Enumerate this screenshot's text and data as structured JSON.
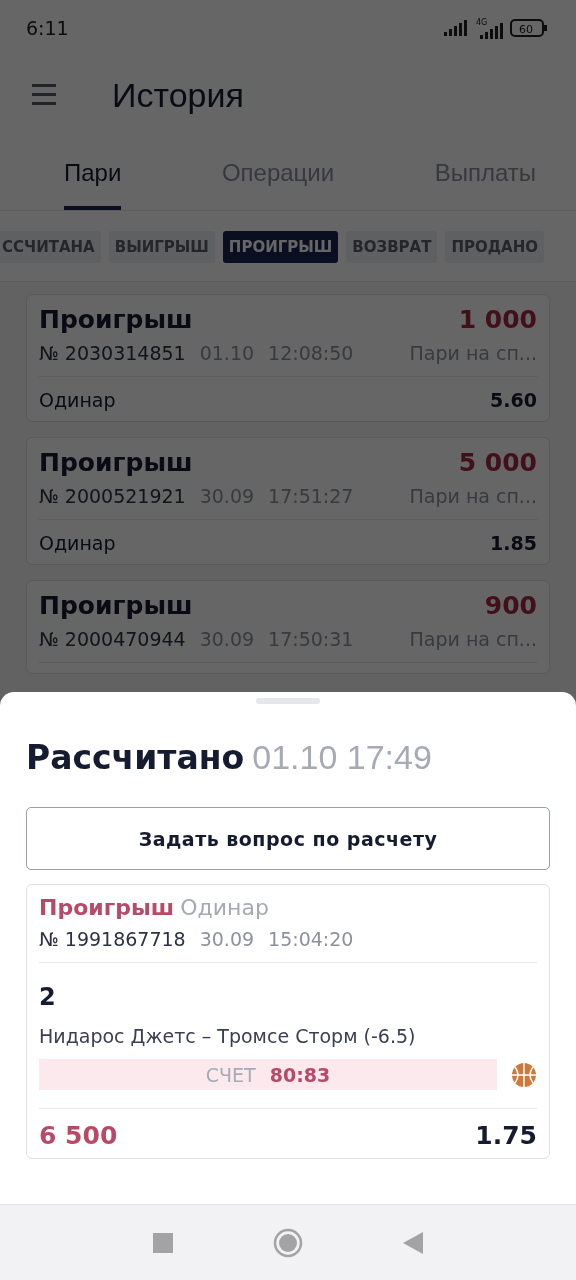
{
  "status_bar": {
    "time": "6:11",
    "network": "4G",
    "battery": "60"
  },
  "header": {
    "title": "История"
  },
  "tabs": [
    {
      "label": "Пари",
      "selected": true
    },
    {
      "label": "Операции",
      "selected": false
    },
    {
      "label": "Выплаты",
      "selected": false
    }
  ],
  "filters": [
    {
      "label": "ССЧИТАНА",
      "selected": false
    },
    {
      "label": "ВЫИГРЫШ",
      "selected": false
    },
    {
      "label": "ПРОИГРЫШ",
      "selected": true
    },
    {
      "label": "ВОЗВРАТ",
      "selected": false
    },
    {
      "label": "ПРОДАНО",
      "selected": false
    }
  ],
  "bets": [
    {
      "status": "Проигрыш",
      "amount": "1 000",
      "number": "№ 2030314851",
      "date": "01.10",
      "time": "12:08:50",
      "category": "Пари на сп...",
      "type": "Одинар",
      "odds": "5.60"
    },
    {
      "status": "Проигрыш",
      "amount": "5 000",
      "number": "№ 2000521921",
      "date": "30.09",
      "time": "17:51:27",
      "category": "Пари на сп...",
      "type": "Одинар",
      "odds": "1.85"
    },
    {
      "status": "Проигрыш",
      "amount": "900",
      "number": "№ 2000470944",
      "date": "30.09",
      "time": "17:50:31",
      "category": "Пари на сп..."
    }
  ],
  "sheet": {
    "title": "Рассчитано",
    "datetime": "01.10 17:49",
    "button": "Задать вопрос по расчету",
    "bet": {
      "status": "Проигрыш",
      "type": "Одинар",
      "number": "№ 1991867718",
      "date": "30.09",
      "time": "15:04:20",
      "outcome": "2",
      "event": "Нидарос Джетс – Тромсе Сторм (-6.5)",
      "score_label": "СЧЕТ",
      "score": "80:83",
      "stake": "6 500",
      "odds": "1.75"
    }
  }
}
